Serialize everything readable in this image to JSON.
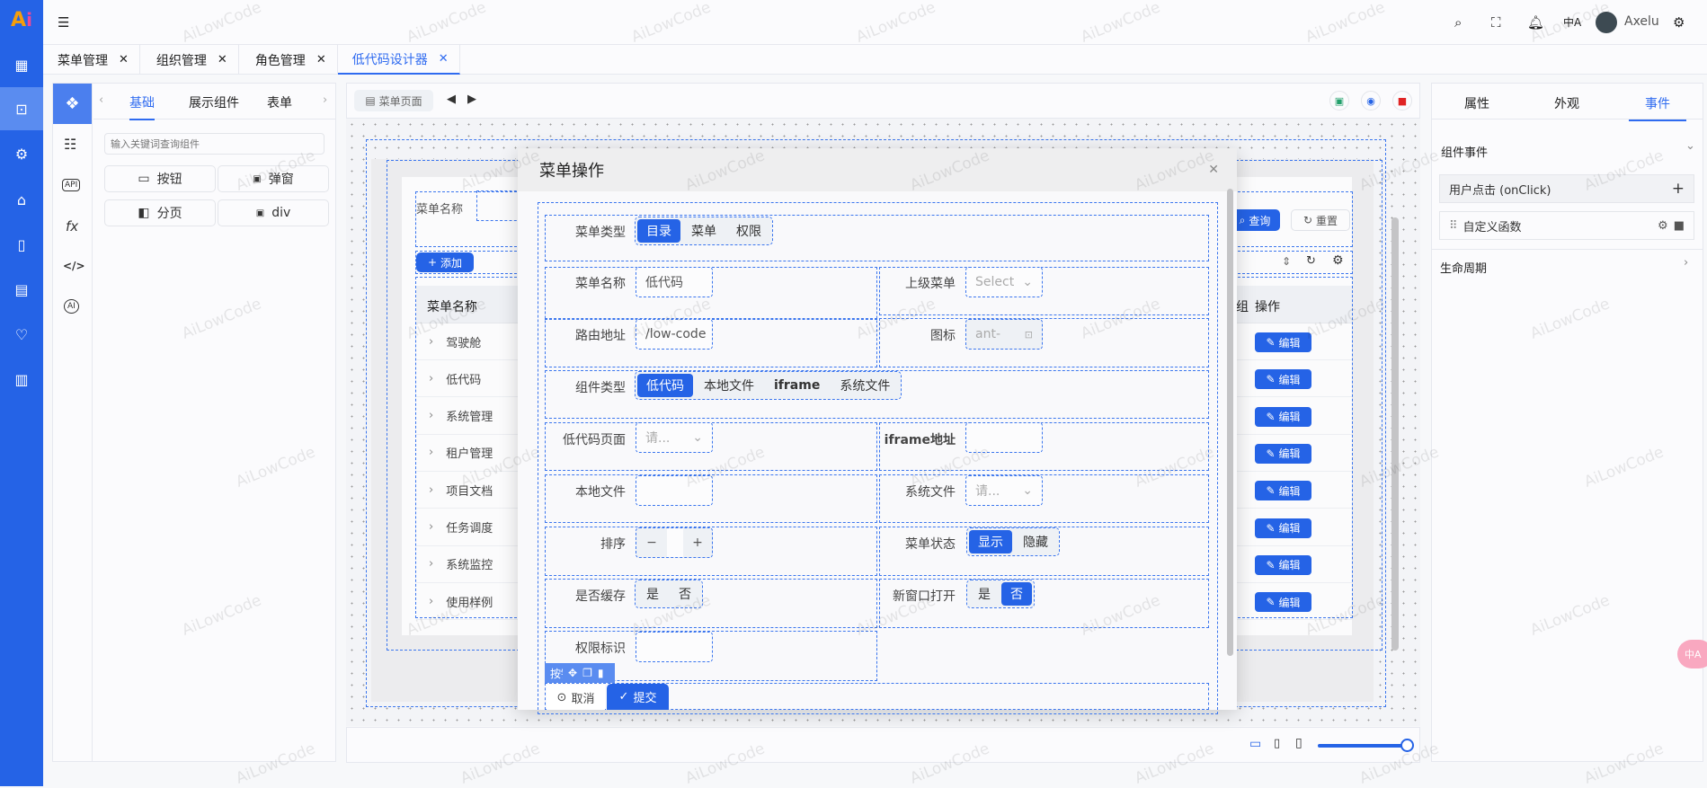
{
  "watermark": "AiLowCode",
  "colors": {
    "primary": "#2563e6",
    "danger": "#e02424",
    "save": "#22a06b"
  },
  "sidebar": {
    "items": [
      {
        "icon": "grid-icon"
      },
      {
        "icon": "terminal-icon",
        "active": true
      },
      {
        "icon": "gear-icon"
      },
      {
        "icon": "home-icon"
      },
      {
        "icon": "book-icon"
      },
      {
        "icon": "calendar-icon"
      },
      {
        "icon": "heart-pulse-icon"
      },
      {
        "icon": "docs-icon"
      }
    ]
  },
  "header": {
    "user": "Axelu"
  },
  "tabs": [
    {
      "label": "菜单管理"
    },
    {
      "label": "组织管理"
    },
    {
      "label": "角色管理"
    },
    {
      "label": "低代码设计器",
      "active": true
    }
  ],
  "tab_close": "✕",
  "left_panel": {
    "tabs": [
      "基础",
      "展示组件",
      "表单"
    ],
    "search_placeholder": "输入关键词查询组件",
    "components": [
      "按钮",
      "弹窗",
      "分页",
      "div"
    ],
    "icons": [
      "API",
      "fx",
      "</>",
      "AI"
    ]
  },
  "canvas": {
    "page_label": "菜单页面",
    "bg": {
      "search_label": "菜单名称",
      "query": "查询",
      "reset": "重置",
      "add": "添加",
      "col_name": "菜单名称",
      "col_group": "组",
      "col_action": "操作",
      "edit": "编辑",
      "rows": [
        "驾驶舱",
        "低代码",
        "系统管理",
        "租户管理",
        "项目文档",
        "任务调度",
        "系统监控",
        "使用样例"
      ]
    }
  },
  "dialog": {
    "title": "菜单操作",
    "menu_type": {
      "label": "菜单类型",
      "options": [
        "目录",
        "菜单",
        "权限"
      ],
      "selected": "目录"
    },
    "menu_name": {
      "label": "菜单名称",
      "value": "低代码"
    },
    "parent_menu": {
      "label": "上级菜单",
      "placeholder": "Select"
    },
    "route": {
      "label": "路由地址",
      "value": "/low-code"
    },
    "icon": {
      "label": "图标",
      "value": "ant-"
    },
    "comp_type": {
      "label": "组件类型",
      "options": [
        "低代码",
        "本地文件",
        "iframe",
        "系统文件"
      ],
      "selected": "低代码"
    },
    "lowcode_page": {
      "label": "低代码页面",
      "placeholder": "请..."
    },
    "iframe_url": {
      "label": "iframe地址"
    },
    "local_file": {
      "label": "本地文件"
    },
    "system_file": {
      "label": "系统文件",
      "placeholder": "请..."
    },
    "order": {
      "label": "排序",
      "minus": "−",
      "plus": "+"
    },
    "status": {
      "label": "菜单状态",
      "options": [
        "显示",
        "隐藏"
      ],
      "selected": "显示"
    },
    "cache": {
      "label": "是否缓存",
      "options": [
        "是",
        "否"
      ],
      "selected": ""
    },
    "new_window": {
      "label": "新窗口打开",
      "options": [
        "是",
        "否"
      ],
      "selected": "否"
    },
    "perm": {
      "label": "权限标识"
    },
    "toolbar_label": "按钮",
    "cancel": "取消",
    "submit": "提交"
  },
  "right_panel": {
    "tabs": [
      "属性",
      "外观",
      "事件"
    ],
    "active_tab": "事件",
    "section1": "组件事件",
    "event": "用户点击 (onClick)",
    "handler": "自定义函数",
    "section2": "生命周期"
  }
}
